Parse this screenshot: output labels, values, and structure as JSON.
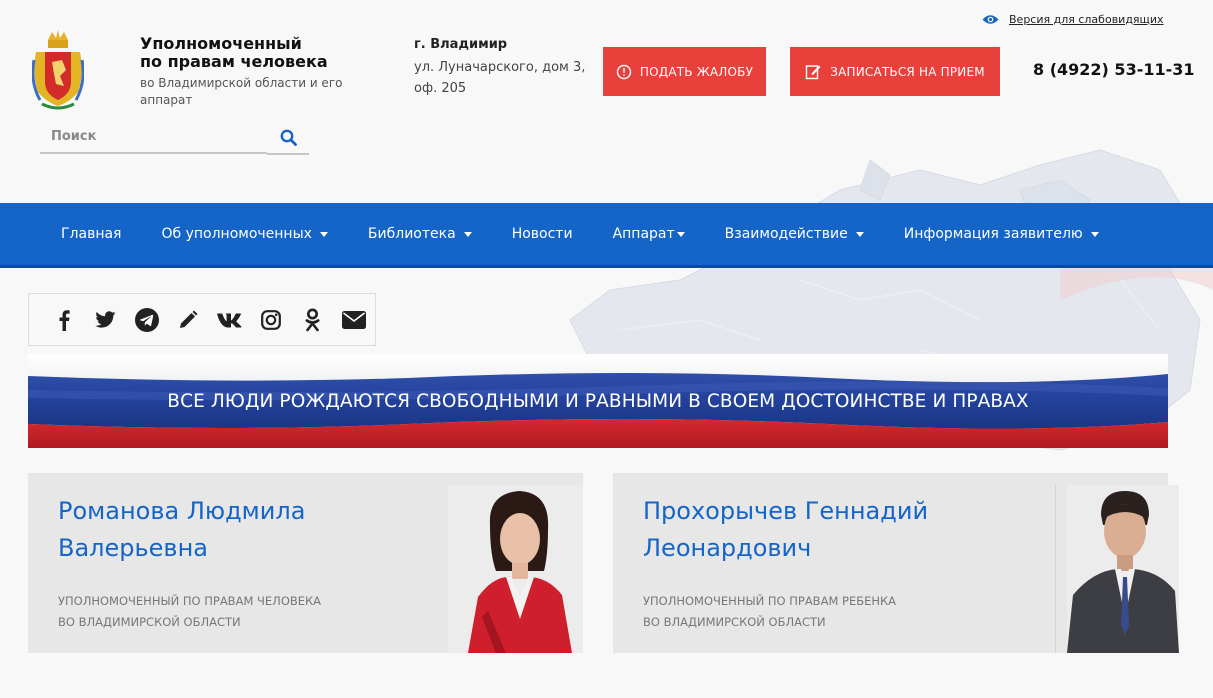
{
  "accessibility": {
    "label": "Версия для слабовидящих",
    "icon": "eye-icon"
  },
  "org": {
    "line1": "Уполномоченный",
    "line2": "по правам человека",
    "line3": "во Владимирской области и его аппарат"
  },
  "address": {
    "city": "г. Владимир",
    "street": "ул. Луначарского, дом 3, оф. 205"
  },
  "buttons": {
    "complaint": "ПОДАТЬ ЖАЛОБУ",
    "appointment": "ЗАПИСАТЬСЯ НА ПРИЕМ"
  },
  "phone": "8 (4922) 53-11-31",
  "search": {
    "placeholder": "Поиск"
  },
  "nav": [
    {
      "label": "Главная",
      "dropdown": false
    },
    {
      "label": "Об уполномоченных",
      "dropdown": true
    },
    {
      "label": "Библиотека",
      "dropdown": true
    },
    {
      "label": "Новости",
      "dropdown": false
    },
    {
      "label": "Аппарат",
      "dropdown": true
    },
    {
      "label": "Взаимодействие",
      "dropdown": true
    },
    {
      "label": "Информация заявителю",
      "dropdown": true
    }
  ],
  "social": [
    "facebook-icon",
    "twitter-icon",
    "telegram-icon",
    "pencil-icon",
    "vk-icon",
    "instagram-icon",
    "odnoklassniki-icon",
    "mail-icon"
  ],
  "banner": {
    "text": "ВСЕ ЛЮДИ РОЖДАЮТСЯ СВОБОДНЫМИ И РАВНЫМИ В СВОЕМ ДОСТОИНСТВЕ И ПРАВАХ"
  },
  "cards": [
    {
      "name1": "Романова Людмила",
      "name2": "Валерьевна",
      "role1": "УПОЛНОМОЧЕННЫЙ ПО ПРАВАМ ЧЕЛОВЕКА",
      "role2": "ВО ВЛАДИМИРСКОЙ ОБЛАСТИ"
    },
    {
      "name1": "Прохорычев Геннадий",
      "name2": "Леонардович",
      "role1": "УПОЛНОМОЧЕННЫЙ ПО ПРАВАМ РЕБЕНКА",
      "role2": "ВО ВЛАДИМИРСКОЙ ОБЛАСТИ"
    }
  ],
  "colors": {
    "brand_blue": "#1565c9",
    "accent_red": "#e8403a",
    "card_bg": "#e7e7e7"
  }
}
